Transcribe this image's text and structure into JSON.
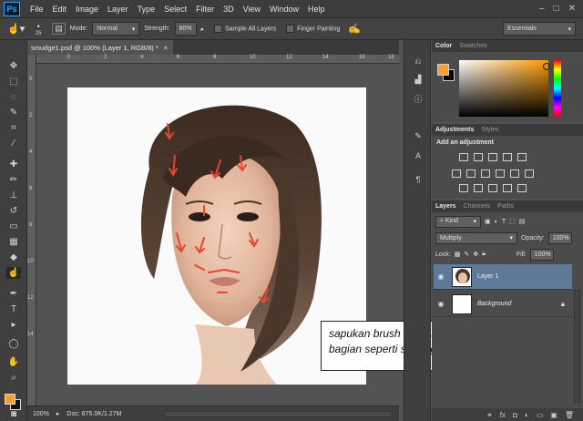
{
  "app": {
    "logo": "Ps"
  },
  "menu": [
    "File",
    "Edit",
    "Image",
    "Layer",
    "Type",
    "Select",
    "Filter",
    "3D",
    "View",
    "Window",
    "Help"
  ],
  "window_buttons": [
    "–",
    "□",
    "✕"
  ],
  "options": {
    "brush_size": "25",
    "mode_label": "Mode:",
    "mode_value": "Normal",
    "strength_label": "Strength:",
    "strength_value": "80%",
    "sample_all_layers": "Sample All Layers",
    "finger_painting": "Finger Painting",
    "workspace": "Essentials"
  },
  "document": {
    "tab_title": "smudge1.psd @ 100% (Layer 1, RGB/8) *",
    "tab_close": "×"
  },
  "ruler": {
    "h_ticks": [
      "0",
      "2",
      "4",
      "6",
      "8",
      "10",
      "12",
      "14",
      "16",
      "18"
    ],
    "v_ticks": [
      "0",
      "2",
      "4",
      "6",
      "8",
      "10",
      "12",
      "14"
    ]
  },
  "status": {
    "zoom": "100%",
    "doc": "Doc: 675.0K/1.27M"
  },
  "caption": {
    "line1": "sapukan brush pada setiap",
    "line2": "bagian seperti sedang melukis"
  },
  "panels": {
    "color_tabs": [
      "Color",
      "Swatches"
    ],
    "adjust_tabs": [
      "Adjustments",
      "Styles"
    ],
    "adjust_title": "Add an adjustment",
    "layers_tabs": [
      "Layers",
      "Channels",
      "Paths"
    ],
    "kind_label": "Kind",
    "blend_mode": "Multiply",
    "opacity_label": "Opacity:",
    "opacity_value": "100%",
    "lock_label": "Lock:",
    "fill_label": "Fill:",
    "fill_value": "100%",
    "layers": [
      {
        "name": "Layer 1",
        "selected": true
      },
      {
        "name": "Background",
        "selected": false
      }
    ]
  },
  "colors": {
    "foreground": "#f6a02d",
    "background": "#000000",
    "selection": "#5f7a98"
  }
}
